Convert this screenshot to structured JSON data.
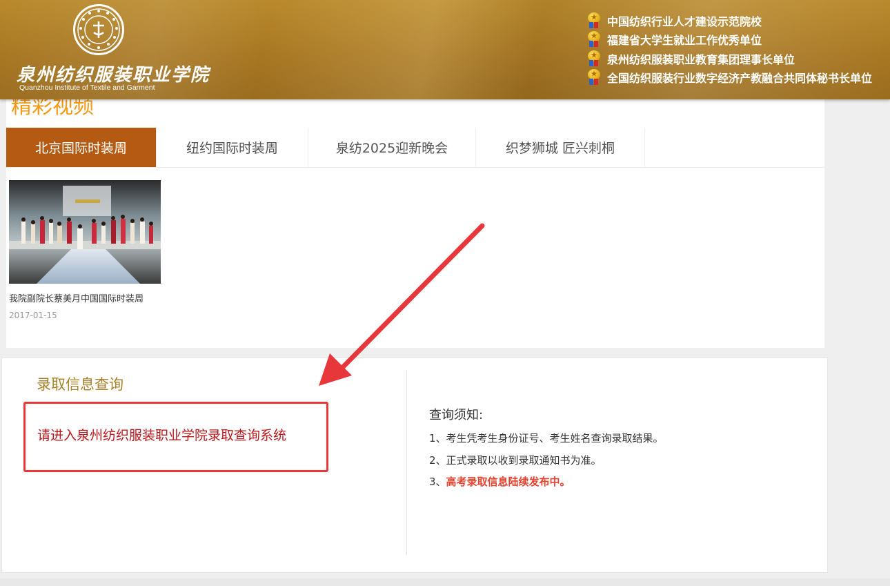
{
  "header": {
    "logo_cn": "泉州纺织服装职业学院",
    "logo_en": "Quanzhou Institute of Textile and Garment",
    "honors": [
      "中国纺织行业人才建设示范院校",
      "福建省大学生就业工作优秀单位",
      "泉州纺织服装职业教育集团理事长单位",
      "全国纺织服装行业数字经济产教融合共同体秘书长单位"
    ]
  },
  "video": {
    "section_title": "精彩视频",
    "tabs": [
      "北京国际时装周",
      "纽约国际时装周",
      "泉纺2025迎新晚会",
      "织梦狮城 匠兴刺桐"
    ],
    "active_tab": 0,
    "items": [
      {
        "caption": "我院副院长蔡美月中国国际时装周",
        "date": "2017-01-15"
      }
    ]
  },
  "query": {
    "title": "录取信息查询",
    "link_text": "请进入泉州纺织服装职业学院录取查询系统",
    "notice_title": "查询须知:",
    "notices": [
      "1、考生凭考生身份证号、考生姓名查询录取结果。",
      "2、正式录取以收到录取通知书为准。"
    ],
    "notice3_prefix": "3、",
    "notice3_highlight": "高考录取信息陆续发布中。"
  },
  "colors": {
    "header_gold": "#a87722",
    "tab_active": "#b45a12",
    "section_orange": "#f39a14",
    "query_title": "#a8822a",
    "link_red": "#b8171b",
    "box_border": "#e8373a",
    "highlight": "#e8422f"
  },
  "icons": [
    "school-emblem-icon",
    "medal-icon",
    "red-arrow-icon"
  ]
}
